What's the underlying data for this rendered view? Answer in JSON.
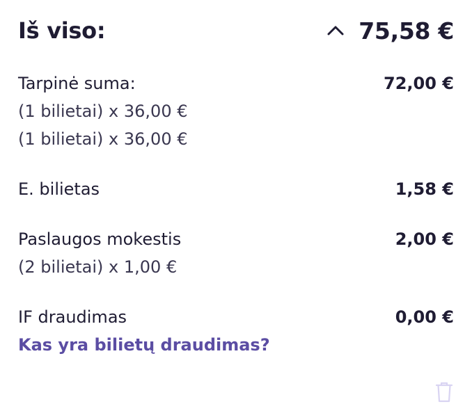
{
  "total": {
    "label": "Iš viso:",
    "amount": "75,58 €"
  },
  "subtotal": {
    "label": "Tarpinė suma:",
    "amount": "72,00 €",
    "details": [
      "(1 bilietai) x 36,00 €",
      "(1 bilietai) x 36,00 €"
    ]
  },
  "eticket": {
    "label": "E. bilietas",
    "amount": "1,58 €"
  },
  "service_fee": {
    "label": "Paslaugos mokestis",
    "amount": "2,00 €",
    "detail": "(2 bilietai) x 1,00 €"
  },
  "insurance": {
    "label": "IF draudimas",
    "amount": "0,00 €",
    "link": "Kas yra bilietų draudimas?"
  },
  "icons": {
    "collapse": "chevron-up-icon",
    "delete": "trash-icon"
  },
  "colors": {
    "text": "#1f1c33",
    "link": "#5b4da3",
    "icon_muted": "#d9d4f2"
  }
}
